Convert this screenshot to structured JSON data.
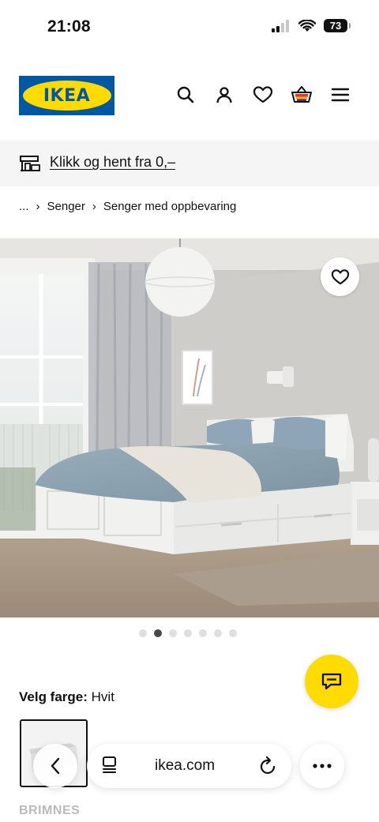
{
  "status_bar": {
    "time": "21:08",
    "battery": "73"
  },
  "header": {
    "logo_text": "IKEA",
    "icons": [
      "search-icon",
      "user-icon",
      "heart-icon",
      "basket-icon",
      "menu-icon"
    ]
  },
  "promo": {
    "link_text": "Klikk og hent fra 0,–",
    "icon": "store-icon"
  },
  "breadcrumb": {
    "ellipsis": "...",
    "items": [
      "Senger",
      "Senger med oppbevaring"
    ]
  },
  "gallery": {
    "slide_count": 7,
    "active_index": 1
  },
  "color_selector": {
    "label": "Velg farge:",
    "value": "Hvit"
  },
  "variant": {
    "name": "BRIMNES"
  },
  "browser": {
    "url": "ikea.com"
  },
  "colors": {
    "ikea_blue": "#0058a3",
    "ikea_yellow": "#ffdb00"
  }
}
